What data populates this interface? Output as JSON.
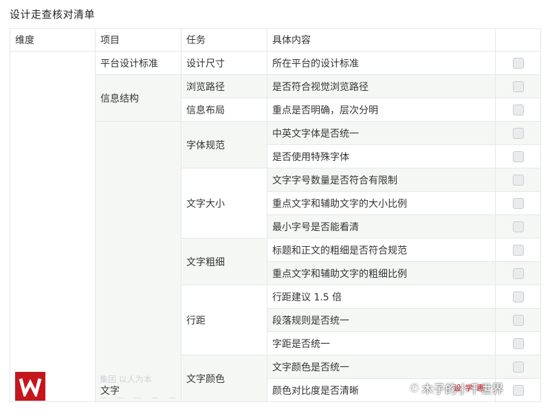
{
  "page_title": "设计走查核对清单",
  "table": {
    "headers": [
      "维度",
      "项目",
      "任务",
      "具体内容",
      ""
    ],
    "dimension_1": "",
    "item_platform": "平台设计标准",
    "item_info": "信息结构",
    "item_text": "文字",
    "tasks": {
      "size": "设计尺寸",
      "browse_path": "浏览路径",
      "info_layout": "信息布局",
      "font_spec": "字体规范",
      "text_size": "文字大小",
      "text_weight": "文字粗细",
      "line_spacing": "行距",
      "text_color": "文字颜色"
    },
    "contents": [
      "所在平台的设计标准",
      "是否符合视觉浏览路径",
      "重点是否明确，层次分明",
      "中英文字体是否统一",
      "是否使用特殊字体",
      "文字字号数量是否符合有限制",
      "重点文字和辅助文字的大小比例",
      "最小字号是否能看清",
      "标题和正文的粗细是否符合规范",
      "重点文字和辅助文字的粗细比例",
      "行距建议 1.5 倍",
      "段落规则是否统一",
      "字距是否统一",
      "文字颜色是否统一",
      "颜色对比度是否清晰"
    ],
    "checked": [
      false,
      false,
      false,
      false,
      false,
      false,
      false,
      false,
      false,
      false,
      false,
      false,
      false,
      false,
      false
    ]
  },
  "overlay": {
    "ghost_text": "集团  以人为本",
    "ghost_sub": "一 一 一 一 一",
    "watermark_account": "木子的小千世界",
    "watermark_stamp": "设 学 惠",
    "logo_letter": "W"
  },
  "colors": {
    "border": "#e4e7ea",
    "shade": "#f5f7f5",
    "logo_red": "#c4161c"
  },
  "icons": [
    "checkbox-icon",
    "wechat-icon",
    "logo-icon"
  ]
}
